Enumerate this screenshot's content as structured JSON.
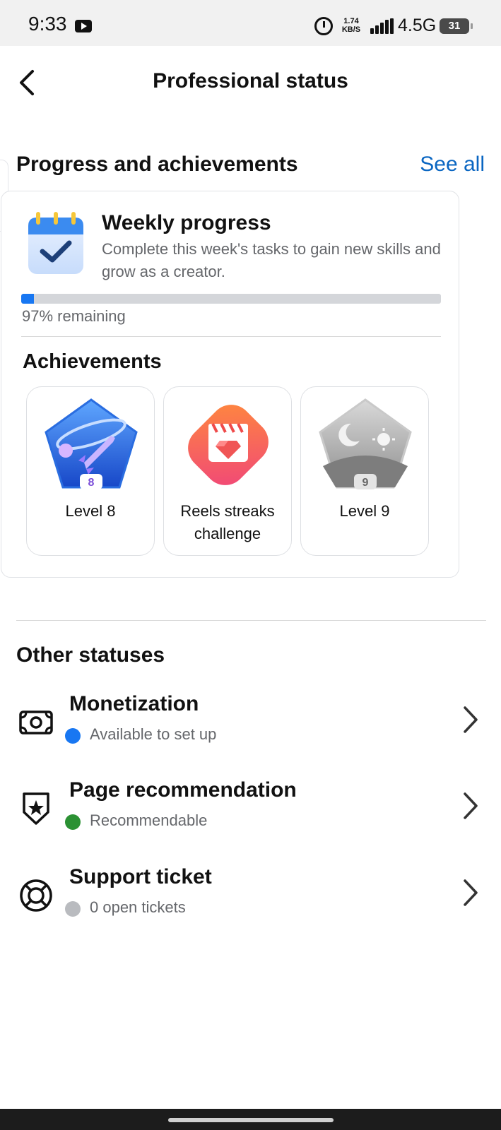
{
  "status_bar": {
    "time": "9:33",
    "speed_value": "1.74",
    "speed_unit": "KB/S",
    "network": "4.5G",
    "battery": "31",
    "icons": [
      "youtube-icon",
      "alarm-icon",
      "signal-icon",
      "battery-icon"
    ]
  },
  "header": {
    "title": "Professional status",
    "back_icon": "chevron-left-icon"
  },
  "progress_section": {
    "title": "Progress and achievements",
    "see_all": "See all"
  },
  "weekly_progress": {
    "title": "Weekly progress",
    "description": "Complete this week's tasks to gain new skills and grow as a creator.",
    "progress_percent": 3,
    "remaining_text": "97% remaining",
    "icon": "calendar-check-icon"
  },
  "achievements": {
    "title": "Achievements",
    "items": [
      {
        "label": "Level 8",
        "badge_number": "8",
        "icon": "rocket-badge-icon"
      },
      {
        "label": "Reels streaks challenge",
        "icon": "reels-diamond-badge-icon"
      },
      {
        "label": "Level 9",
        "badge_number": "9",
        "icon": "moon-sun-badge-icon"
      }
    ]
  },
  "other_statuses": {
    "title": "Other statuses",
    "items": [
      {
        "title": "Monetization",
        "status": "Available to set up",
        "dot_color": "#1877f2",
        "icon": "money-icon"
      },
      {
        "title": "Page recommendation",
        "status": "Recommendable",
        "dot_color": "#2b9133",
        "icon": "shield-star-icon"
      },
      {
        "title": "Support ticket",
        "status": "0 open tickets",
        "dot_color": "#b9bbbf",
        "icon": "lifebuoy-icon"
      }
    ]
  },
  "colors": {
    "accent": "#0a66c2",
    "progress": "#1877f2",
    "secondary_text": "#65676b"
  }
}
